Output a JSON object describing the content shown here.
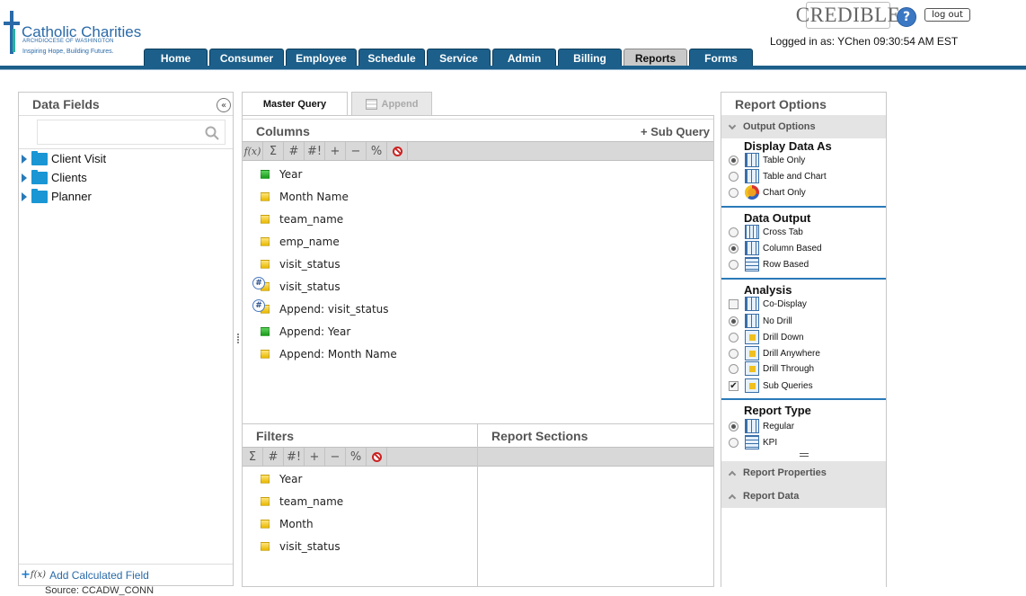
{
  "header": {
    "logo": {
      "name": "Catholic Charities",
      "sub": "ARCHDIOCESE OF WASHINGTON",
      "tagline": "Inspiring Hope, Building Futures."
    },
    "brand": "CREDIBLE",
    "help_icon": "?",
    "logout_label": "log out",
    "login_info": "Logged in as: YChen   09:30:54 AM  EST",
    "nav": [
      {
        "label": "Home",
        "active": false
      },
      {
        "label": "Consumer",
        "active": false
      },
      {
        "label": "Employee",
        "active": false
      },
      {
        "label": "Schedule",
        "active": false
      },
      {
        "label": "Service",
        "active": false
      },
      {
        "label": "Admin",
        "active": false
      },
      {
        "label": "Billing",
        "active": false
      },
      {
        "label": "Reports",
        "active": true
      },
      {
        "label": "Forms",
        "active": false
      }
    ]
  },
  "data_fields": {
    "title": "Data Fields",
    "collapse_icon": "«",
    "search_placeholder": "",
    "tree": [
      {
        "label": "Client Visit"
      },
      {
        "label": "Clients"
      },
      {
        "label": "Planner"
      }
    ],
    "add_calculated": "Add Calculated Field",
    "fx_icon": "f(x)",
    "source": "Source: CCADW_CONN"
  },
  "query_tabs": [
    {
      "label": "Master Query",
      "active": true
    },
    {
      "label": "Append",
      "active": false
    }
  ],
  "columns": {
    "title": "Columns",
    "sub_query": "+ Sub Query",
    "toolbar": [
      "f(x)",
      "Σ",
      "#",
      "#!",
      "+",
      "−",
      "%",
      "no"
    ],
    "items": [
      {
        "label": "Year",
        "icon": "green",
        "hash": false
      },
      {
        "label": "Month Name",
        "icon": "yellow",
        "hash": false
      },
      {
        "label": "team_name",
        "icon": "yellow",
        "hash": false
      },
      {
        "label": "emp_name",
        "icon": "yellow",
        "hash": false
      },
      {
        "label": "visit_status",
        "icon": "yellow",
        "hash": false
      },
      {
        "label": "visit_status",
        "icon": "yellow",
        "hash": true
      },
      {
        "label": "Append: visit_status",
        "icon": "yellow",
        "hash": true
      },
      {
        "label": "Append: Year",
        "icon": "green",
        "hash": false
      },
      {
        "label": "Append: Month Name",
        "icon": "yellow",
        "hash": false
      }
    ]
  },
  "filters": {
    "title": "Filters",
    "toolbar": [
      "Σ",
      "#",
      "#!",
      "+",
      "−",
      "%",
      "no"
    ],
    "items": [
      {
        "label": "Year"
      },
      {
        "label": "team_name"
      },
      {
        "label": "Month"
      },
      {
        "label": "visit_status"
      }
    ]
  },
  "report_sections": {
    "title": "Report Sections"
  },
  "report_options": {
    "title": "Report Options",
    "output_options": "Output Options",
    "groups": [
      {
        "title": "Display Data As",
        "kind": "radio",
        "options": [
          {
            "label": "Table Only",
            "checked": true,
            "icon": "table"
          },
          {
            "label": "Table and Chart",
            "checked": false,
            "icon": "chart"
          },
          {
            "label": "Chart Only",
            "checked": false,
            "icon": "chart"
          }
        ]
      },
      {
        "title": "Data Output",
        "kind": "radio",
        "options": [
          {
            "label": "Cross Tab",
            "checked": false,
            "icon": "grid"
          },
          {
            "label": "Column Based",
            "checked": true,
            "icon": "table"
          },
          {
            "label": "Row Based",
            "checked": false,
            "icon": "rows"
          }
        ]
      },
      {
        "title": "Analysis",
        "kind": "mixed",
        "options": [
          {
            "label": "Co-Display",
            "checked": false,
            "icon": "table",
            "type": "checkbox"
          },
          {
            "label": "No Drill",
            "checked": true,
            "icon": "table",
            "type": "radio"
          },
          {
            "label": "Drill Down",
            "checked": false,
            "icon": "drill",
            "type": "radio"
          },
          {
            "label": "Drill Anywhere",
            "checked": false,
            "icon": "drill",
            "type": "radio"
          },
          {
            "label": "Drill Through",
            "checked": false,
            "icon": "drill",
            "type": "radio"
          },
          {
            "label": "Sub Queries",
            "checked": true,
            "icon": "drill",
            "type": "checkbox"
          }
        ]
      },
      {
        "title": "Report Type",
        "kind": "radio",
        "options": [
          {
            "label": "Regular",
            "checked": true,
            "icon": "table"
          },
          {
            "label": "KPI",
            "checked": false,
            "icon": "rows"
          }
        ]
      }
    ],
    "report_properties": "Report Properties",
    "report_data": "Report Data"
  }
}
